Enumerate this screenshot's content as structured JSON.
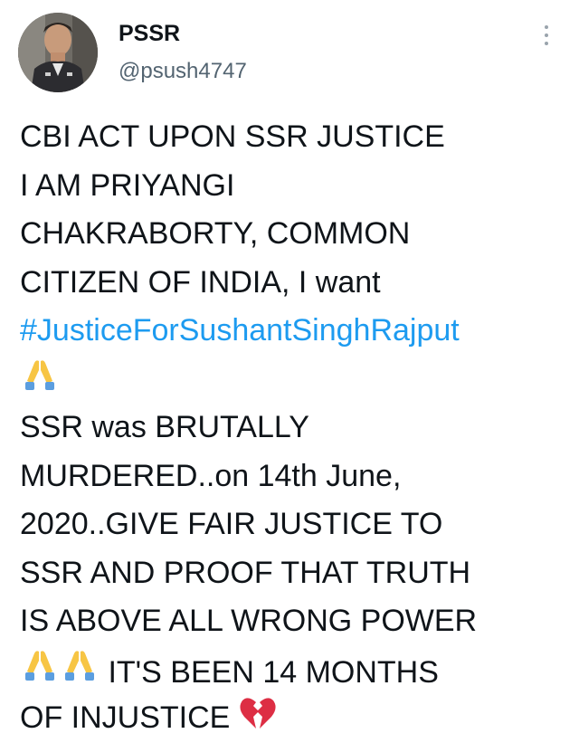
{
  "tweet": {
    "author": {
      "display_name": "PSSR",
      "handle": "@psush4747",
      "avatar_icon": "profile-photo"
    },
    "more_icon": "more-vertical-icon",
    "text": {
      "line1": "CBI ACT UPON SSR JUSTICE",
      "line2": "I AM PRIYANGI",
      "line3": "CHAKRABORTY, COMMON",
      "line4": "CITIZEN OF INDIA, I want",
      "hashtag": "#JusticeForSushantSinghRajput",
      "line6": "SSR was BRUTALLY",
      "line7": "MURDERED..on 14th June,",
      "line8": "2020..GIVE FAIR JUSTICE TO",
      "line9": "SSR AND PROOF THAT TRUTH",
      "line10": "IS ABOVE ALL WRONG POWER",
      "line11": "IT'S BEEN 14 MONTHS",
      "line12": "OF INJUSTICE"
    },
    "emojis": {
      "pray": "folded-hands-icon",
      "broken_heart": "broken-heart-icon"
    },
    "colors": {
      "text": "#0f1419",
      "secondary": "#536471",
      "link": "#1d9bf0",
      "emoji_hands": "#f7c544",
      "emoji_sleeve": "#5b9ee0",
      "broken_heart": "#dd2e44"
    }
  }
}
